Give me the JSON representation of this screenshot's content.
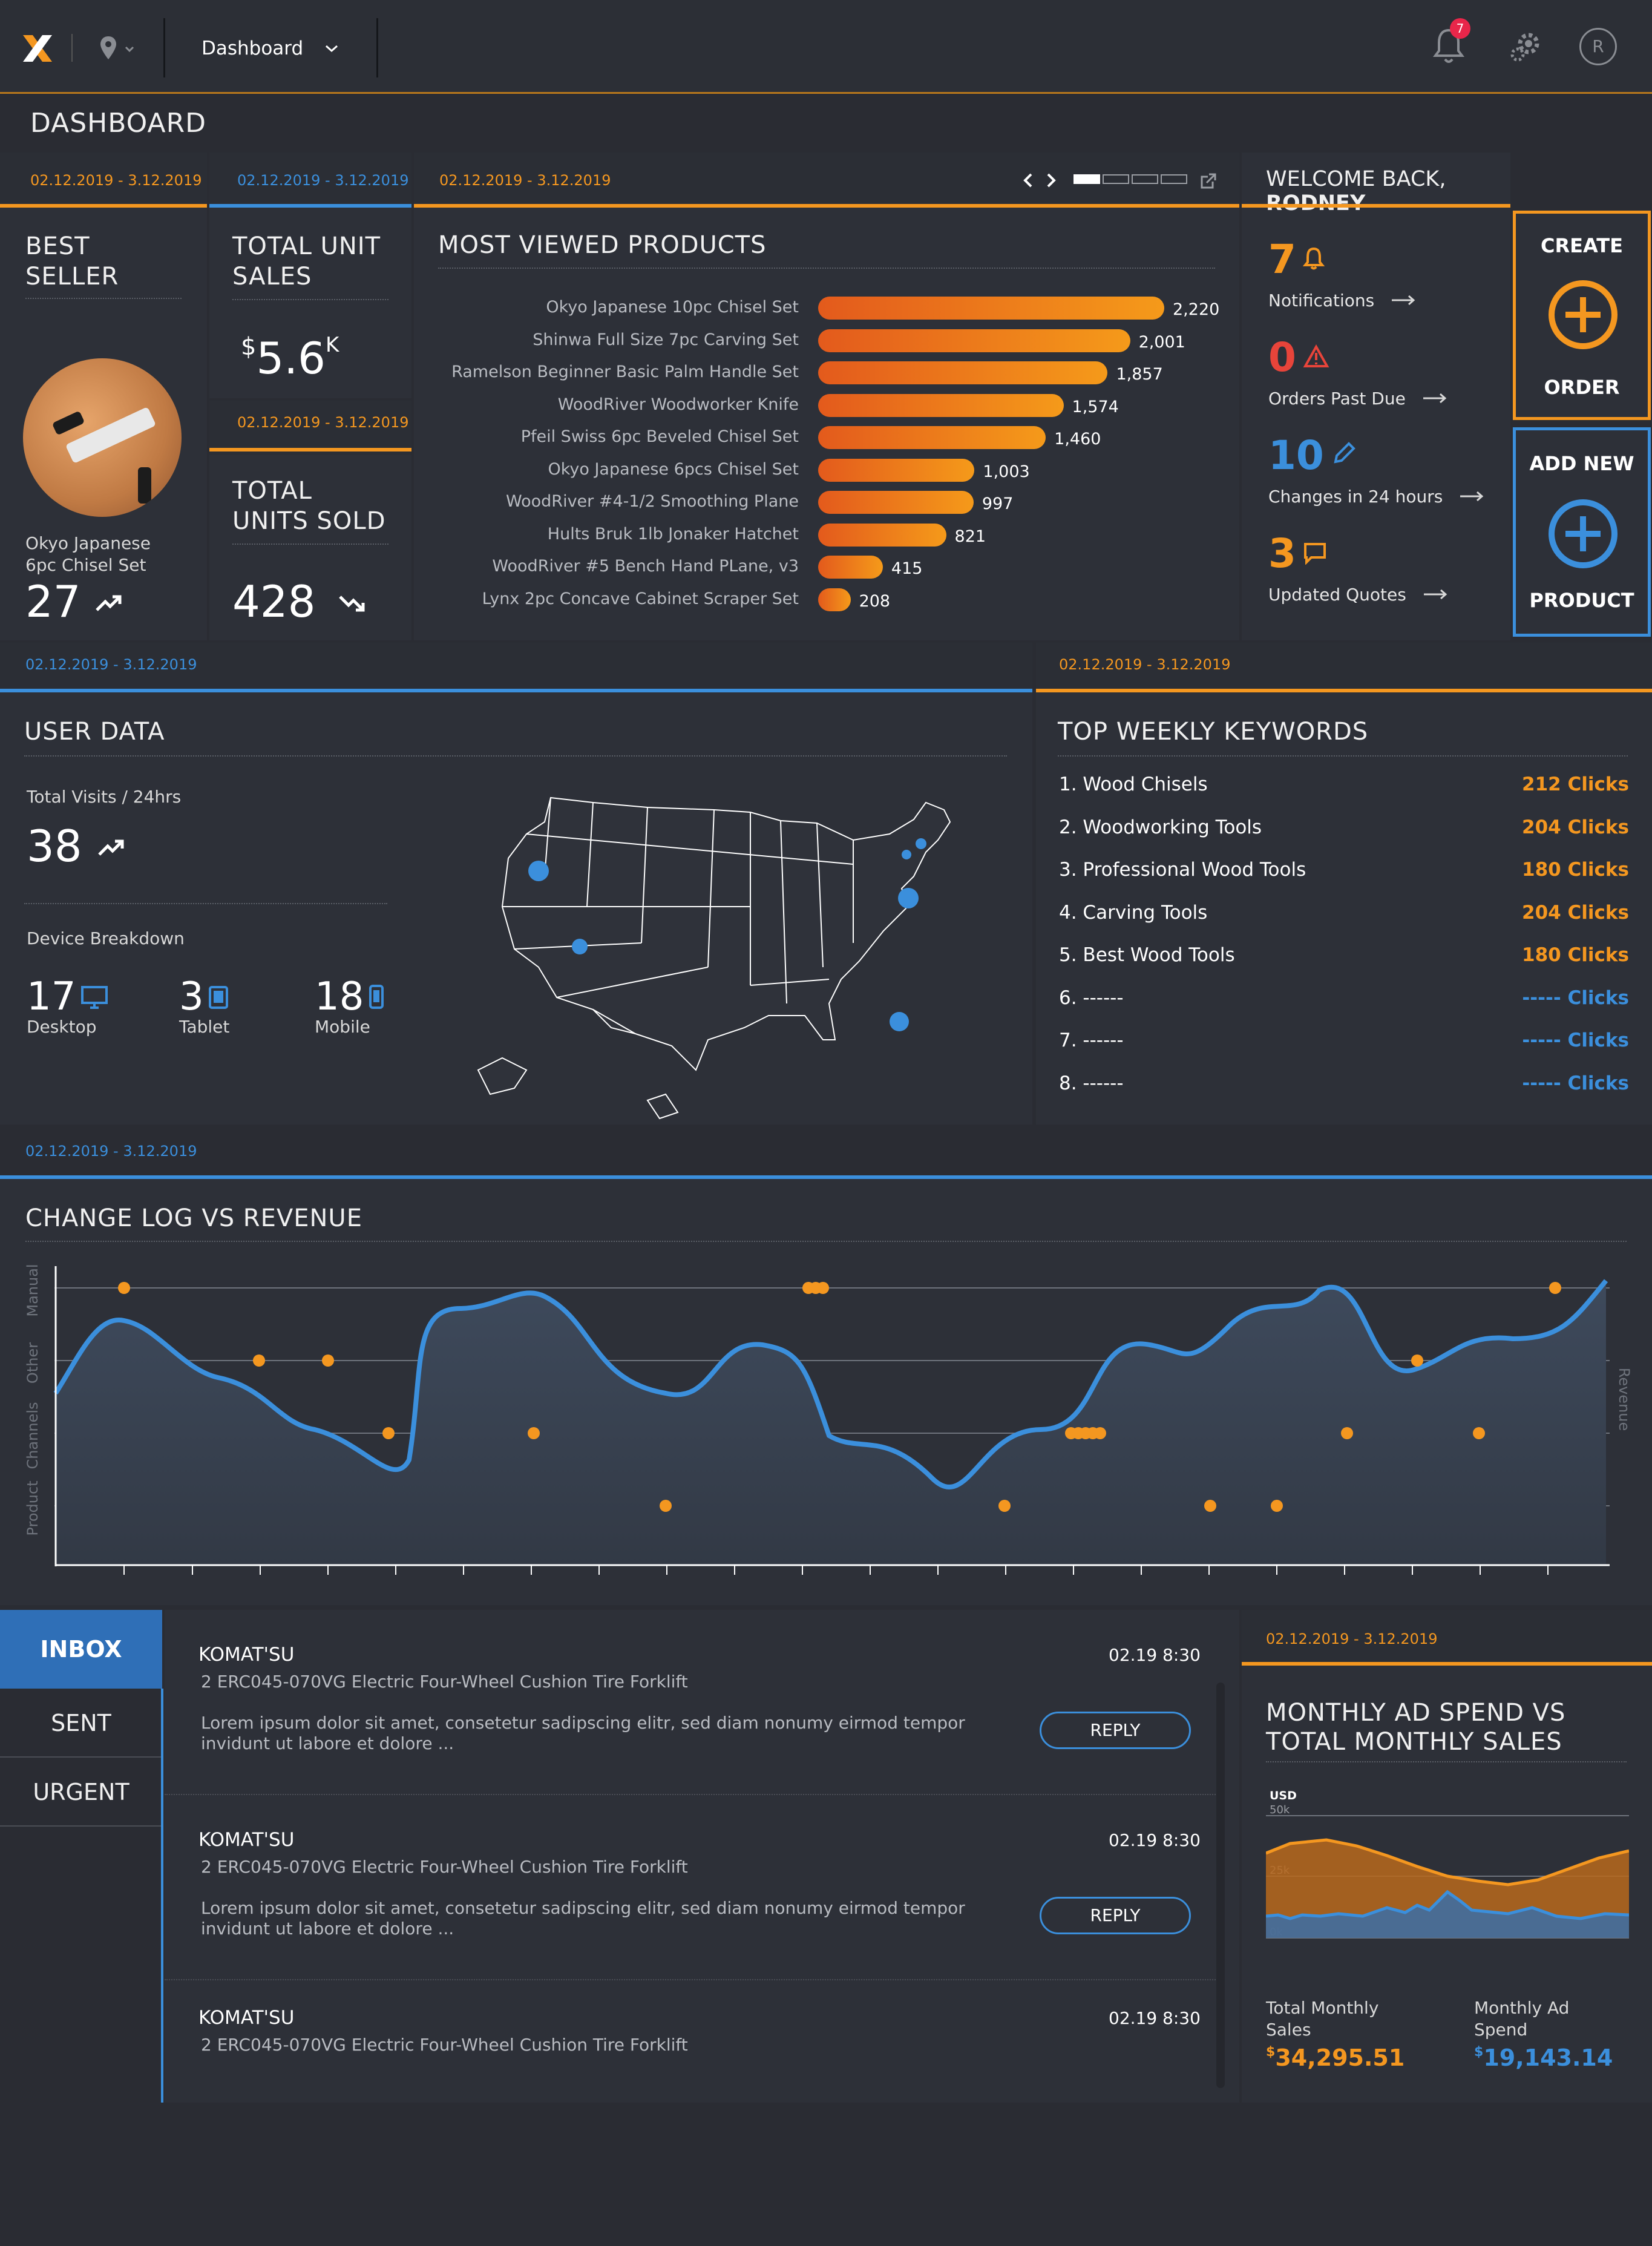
{
  "topbar": {
    "menu_label": "Dashboard",
    "notif_count": "7",
    "avatar_initial": "R"
  },
  "page_title": "DASHBOARD",
  "date_range": "02.12.2019 - 3.12.2019",
  "best_seller": {
    "title_line1": "BEST",
    "title_line2": "SELLER",
    "product_line1": "Okyo Japanese",
    "product_line2": "6pc Chisel Set",
    "value": "27"
  },
  "total_unit_sales": {
    "title_line1": "TOTAL UNIT",
    "title_line2": "SALES",
    "currency": "$",
    "value": "5.6",
    "suffix": "K"
  },
  "total_units_sold": {
    "title_line1": "TOTAL",
    "title_line2": "UNITS SOLD",
    "value": "428"
  },
  "most_viewed": {
    "title": "MOST VIEWED PRODUCTS",
    "items": [
      {
        "name": "Okyo Japanese 10pc Chisel Set",
        "value": 2220,
        "label": "2,220"
      },
      {
        "name": "Shinwa Full Size 7pc Carving Set",
        "value": 2001,
        "label": "2,001"
      },
      {
        "name": "Ramelson Beginner Basic Palm Handle Set",
        "value": 1857,
        "label": "1,857"
      },
      {
        "name": "WoodRiver Woodworker Knife",
        "value": 1574,
        "label": "1,574"
      },
      {
        "name": "Pfeil Swiss 6pc Beveled Chisel Set",
        "value": 1460,
        "label": "1,460"
      },
      {
        "name": "Okyo Japanese 6pcs Chisel Set",
        "value": 1003,
        "label": "1,003"
      },
      {
        "name": "WoodRiver #4-1/2 Smoothing Plane",
        "value": 997,
        "label": "997"
      },
      {
        "name": "Hults Bruk 1lb Jonaker Hatchet",
        "value": 821,
        "label": "821"
      },
      {
        "name": "WoodRiver #5 Bench Hand PLane, v3",
        "value": 415,
        "label": "415"
      },
      {
        "name": "Lynx 2pc Concave Cabinet Scraper Set",
        "value": 208,
        "label": "208"
      }
    ]
  },
  "welcome": {
    "prefix": "WELCOME BACK, ",
    "name": "RODNEY"
  },
  "stats": [
    {
      "value": "7",
      "label": "Notifications",
      "color": "#f49720"
    },
    {
      "value": "0",
      "label": "Orders Past Due",
      "color": "#e8443a"
    },
    {
      "value": "10",
      "label": "Changes in 24 hours",
      "color": "#3b8fdc"
    },
    {
      "value": "3",
      "label": "Updated Quotes",
      "color": "#f49720"
    }
  ],
  "create_order": {
    "top": "CREATE",
    "bottom": "ORDER"
  },
  "add_product": {
    "top": "ADD NEW",
    "bottom": "PRODUCT"
  },
  "user_data": {
    "title": "USER DATA",
    "visits_label": "Total Visits / 24hrs",
    "visits": "38",
    "device_label": "Device Breakdown",
    "devices": [
      {
        "value": "17",
        "label": "Desktop"
      },
      {
        "value": "3",
        "label": "Tablet"
      },
      {
        "value": "18",
        "label": "Mobile"
      }
    ]
  },
  "keywords": {
    "title": "TOP WEEKLY KEYWORDS",
    "items": [
      {
        "name": "1. Wood Chisels",
        "clicks": "212 Clicks"
      },
      {
        "name": "2. Woodworking Tools",
        "clicks": "204 Clicks"
      },
      {
        "name": "3. Professional Wood Tools",
        "clicks": "180 Clicks"
      },
      {
        "name": "4. Carving Tools",
        "clicks": "204 Clicks"
      },
      {
        "name": "5. Best Wood Tools",
        "clicks": "180 Clicks"
      },
      {
        "name": "6. ------",
        "clicks": "----- Clicks"
      },
      {
        "name": "7. ------",
        "clicks": "----- Clicks"
      },
      {
        "name": "8. ------",
        "clicks": "----- Clicks"
      }
    ]
  },
  "changelog": {
    "title": "CHANGE LOG VS REVENUE",
    "y_labels": [
      "Manual",
      "Other",
      "Channels",
      "Product"
    ],
    "right_label": "Revenue"
  },
  "inbox": {
    "tabs": [
      "INBOX",
      "SENT",
      "URGENT"
    ],
    "messages": [
      {
        "from": "KOMAT'SU",
        "subject": "2 ERC045-070VG Electric Four-Wheel Cushion Tire Forklift",
        "date": "02.19 8:30",
        "body1": "Lorem ipsum dolor sit amet, consetetur sadipscing elitr, sed diam nonumy eirmod tempor",
        "body2": "invidunt ut labore et dolore ...",
        "reply": "REPLY"
      },
      {
        "from": "KOMAT'SU",
        "subject": "2 ERC045-070VG Electric Four-Wheel Cushion Tire Forklift",
        "date": "02.19 8:30",
        "body1": "Lorem ipsum dolor sit amet, consetetur sadipscing elitr, sed diam nonumy eirmod tempor",
        "body2": "invidunt ut labore et dolore ...",
        "reply": "REPLY"
      },
      {
        "from": "KOMAT'SU",
        "subject": "2 ERC045-070VG Electric Four-Wheel Cushion Tire Forklift",
        "date": "02.19 8:30"
      }
    ]
  },
  "ad_spend": {
    "title_line1": "MONTHLY AD SPEND VS",
    "title_line2": "TOTAL MONTHLY SALES",
    "unit": "USD",
    "ticks": [
      "50k",
      "25k",
      "0k"
    ],
    "sales_label_1": "Total Monthly",
    "sales_label_2": "Sales",
    "sales_currency": "$",
    "sales_value": "34,295.51",
    "spend_label_1": "Monthly Ad",
    "spend_label_2": "Spend",
    "spend_currency": "$",
    "spend_value": "19,143.14"
  },
  "chart_data": {
    "type": "bar",
    "title": "MOST VIEWED PRODUCTS",
    "categories": [
      "Okyo Japanese 10pc Chisel Set",
      "Shinwa Full Size 7pc Carving Set",
      "Ramelson Beginner Basic Palm Handle Set",
      "WoodRiver Woodworker Knife",
      "Pfeil Swiss 6pc Beveled Chisel Set",
      "Okyo Japanese 6pcs Chisel Set",
      "WoodRiver #4-1/2 Smoothing Plane",
      "Hults Bruk 1lb Jonaker Hatchet",
      "WoodRiver #5 Bench Hand PLane, v3",
      "Lynx 2pc Concave Cabinet Scraper Set"
    ],
    "values": [
      2220,
      2001,
      1857,
      1574,
      1460,
      1003,
      997,
      821,
      415,
      208
    ]
  }
}
